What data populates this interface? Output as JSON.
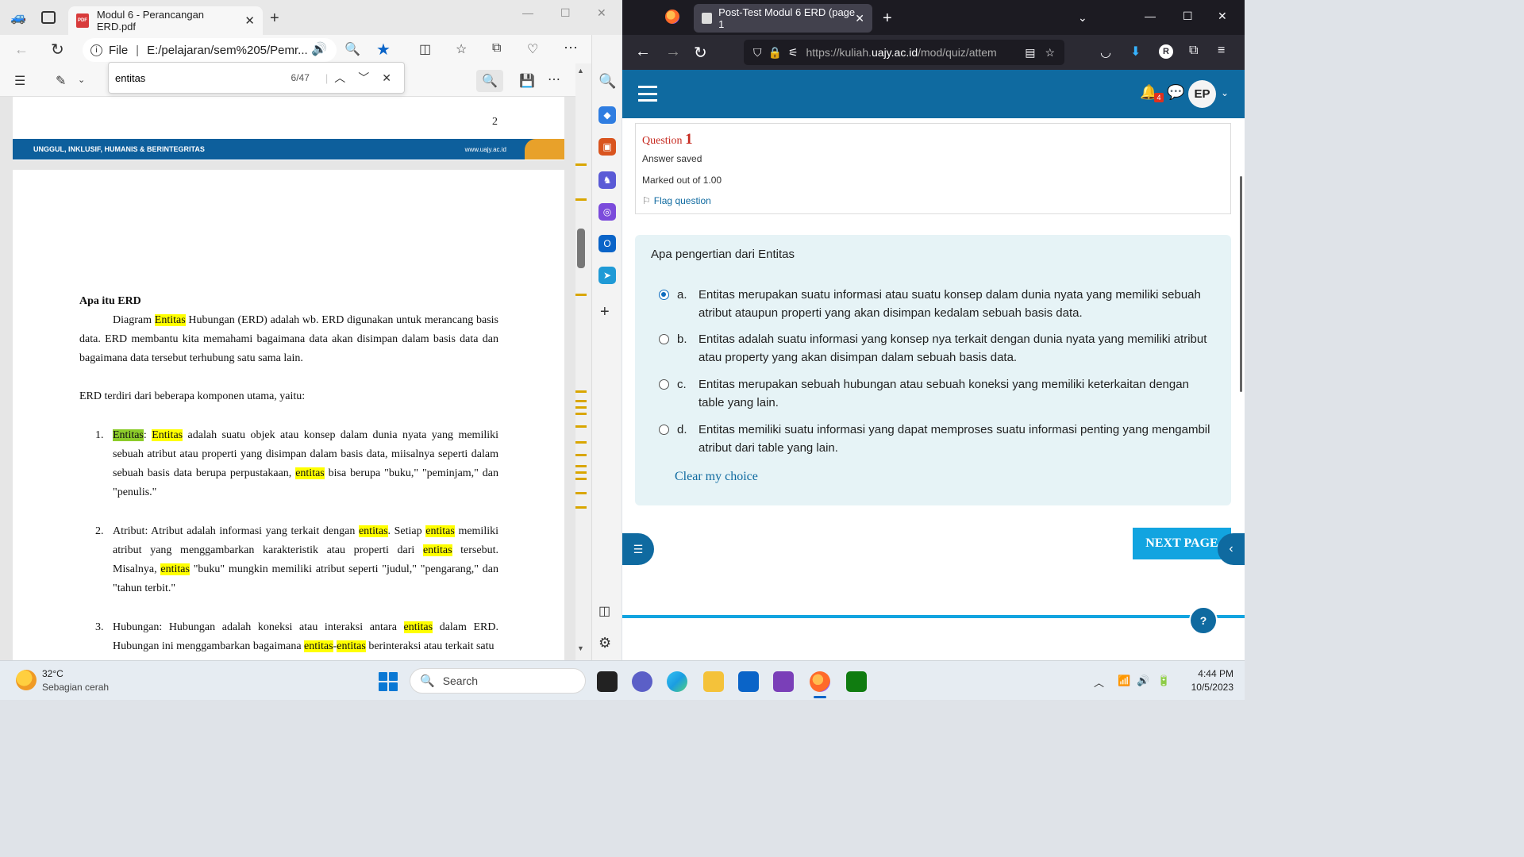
{
  "edge": {
    "tab_title": "Modul 6 - Perancangan ERD.pdf",
    "addr_scheme": "File",
    "addr_path": "E:/pelajaran/sem%205/Pemr...",
    "find_query": "entitas",
    "find_count": "6/47",
    "page_number": "2",
    "footer_slogan": "UNGGUL, INKLUSIF, HUMANIS & BERINTEGRITAS",
    "footer_url": "www.uajy.ac.id",
    "pdf": {
      "heading": "Apa itu ERD",
      "p1_a": "Diagram ",
      "p1_hl": "Entitas",
      "p1_b": " Hubungan (ERD) adalah wb. ERD digunakan untuk merancang basis data. ERD membantu kita memahami bagaimana data akan disimpan dalam basis data dan bagaimana data tersebut terhubung satu sama lain.",
      "p2": "ERD terdiri dari beberapa komponen utama, yaitu:",
      "item1_num": "1.",
      "item1_hl_cur": "Entitas",
      "item1_colon": ": ",
      "item1_hl": "Entitas",
      "item1_a": " adalah suatu objek atau konsep dalam dunia nyata yang memiliki sebuah atribut atau properti yang  disimpan dalam basis data, miisalnya seperti dalam sebuah basis data berupa perpustakaan, ",
      "item1_hl2": "entitas",
      "item1_b": " bisa berupa \"buku,\" \"peminjam,\" dan \"penulis.\"",
      "item2_num": "2.",
      "item2_a": "Atribut: Atribut adalah informasi yang terkait dengan ",
      "item2_hl1": "entitas",
      "item2_b": ". Setiap ",
      "item2_hl2": "entitas",
      "item2_c": " memiliki atribut yang menggambarkan karakteristik atau properti dari ",
      "item2_hl3": "entitas",
      "item2_d": " tersebut. Misalnya, ",
      "item2_hl4": "entitas",
      "item2_e": " \"buku\" mungkin memiliki atribut seperti \"judul,\" \"pengarang,\" dan \"tahun terbit.\"",
      "item3_num": "3.",
      "item3_a": "Hubungan: Hubungan adalah koneksi atau interaksi antara ",
      "item3_hl1": "entitas",
      "item3_b": " dalam ERD. Hubungan ini menggambarkan bagaimana ",
      "item3_hl2": "entitas",
      "item3_dash": "-",
      "item3_hl3": "entitas",
      "item3_c": " berinteraksi atau terkait satu"
    }
  },
  "firefox": {
    "tab_title": "Post-Test Modul 6 ERD (page 1",
    "url_prefix": "https://kuliah.",
    "url_host": "uajy.ac.id",
    "url_path": "/mod/quiz/attem",
    "notif_count": "4",
    "avatar_initials": "EP"
  },
  "quiz": {
    "q_label": "Question ",
    "q_number": "1",
    "status": "Answer saved",
    "marks": "Marked out of 1.00",
    "flag": "Flag question",
    "question": "Apa pengertian dari Entitas",
    "options": [
      {
        "letter": "a.",
        "text": "Entitas merupakan suatu informasi atau suatu konsep dalam dunia nyata yang memiliki sebuah atribut ataupun properti yang akan disimpan kedalam sebuah basis data.",
        "selected": true
      },
      {
        "letter": "b.",
        "text": "Entitas adalah suatu informasi yang konsep nya terkait dengan dunia nyata yang memiliki atribut atau property yang akan disimpan dalam sebuah basis data.",
        "selected": false
      },
      {
        "letter": "c.",
        "text": "Entitas merupakan sebuah hubungan atau sebuah koneksi yang memiliki keterkaitan dengan table yang lain.",
        "selected": false
      },
      {
        "letter": "d.",
        "text": "Entitas memiliki suatu informasi yang dapat memproses suatu informasi penting yang mengambil atribut dari table yang lain.",
        "selected": false
      }
    ],
    "clear": "Clear my choice",
    "next": "NEXT PAGE",
    "help": "?"
  },
  "taskbar": {
    "temp": "32°C",
    "weather": "Sebagian cerah",
    "search": "Search",
    "time": "4:44 PM",
    "date": "10/5/2023"
  },
  "colors": {
    "moodle_blue": "#0f6aa0",
    "highlight": "#ffff00",
    "highlight_current": "#8ccc2a",
    "question_red": "#c6291f"
  }
}
